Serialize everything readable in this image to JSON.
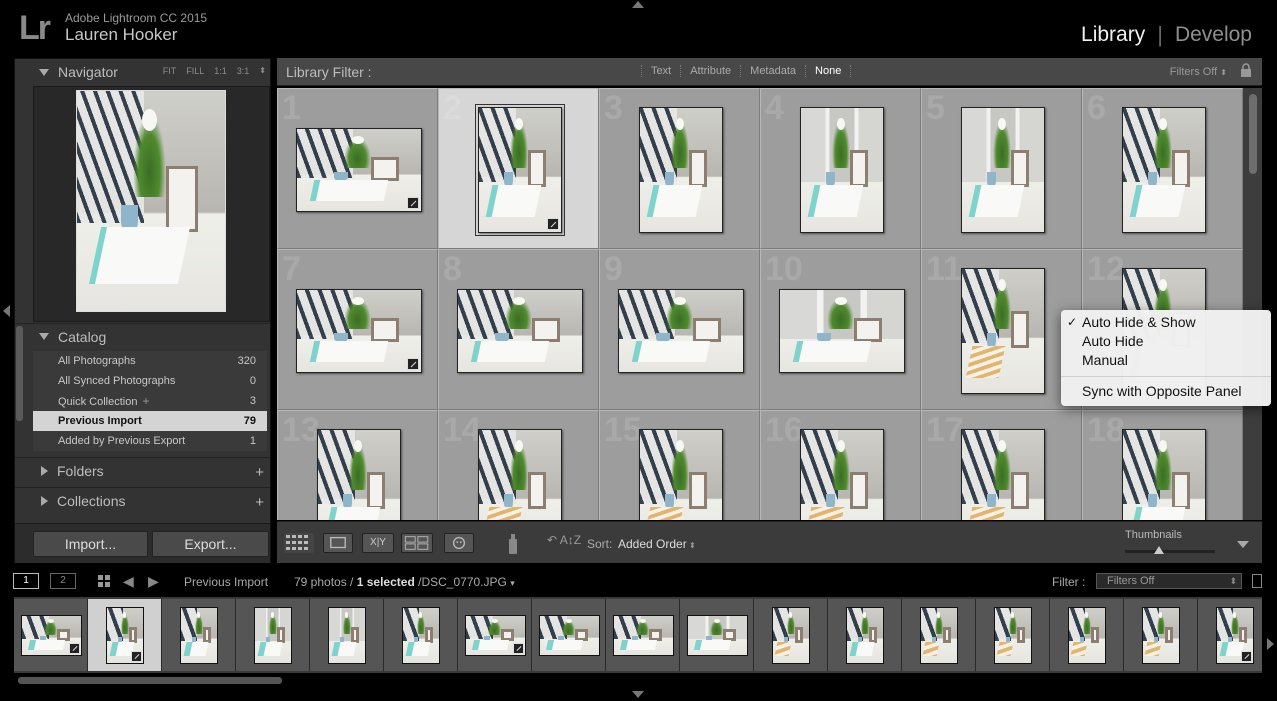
{
  "app": {
    "logo": "Lr",
    "product": "Adobe Lightroom CC 2015",
    "user": "Lauren Hooker",
    "modules": [
      "Library",
      "Develop"
    ],
    "active_module": "Library"
  },
  "navigator": {
    "title": "Navigator",
    "modes": [
      "FIT",
      "FILL",
      "1:1",
      "3:1"
    ]
  },
  "catalog": {
    "title": "Catalog",
    "items": [
      {
        "label": "All Photographs",
        "count": "320"
      },
      {
        "label": "All Synced Photographs",
        "count": "0"
      },
      {
        "label": "Quick Collection",
        "count": "3",
        "plus": "+"
      },
      {
        "label": "Previous Import",
        "count": "79",
        "selected": true
      },
      {
        "label": "Added by Previous Export",
        "count": "1"
      }
    ]
  },
  "folders": {
    "title": "Folders",
    "add": "+"
  },
  "collections": {
    "title": "Collections",
    "add": "+"
  },
  "left_buttons": {
    "import": "Import...",
    "export": "Export..."
  },
  "library_filter": {
    "title": "Library Filter :",
    "tabs": [
      "Text",
      "Attribute",
      "Metadata",
      "None"
    ],
    "active_tab": "None",
    "preset": "Filters Off"
  },
  "grid": {
    "cells": [
      {
        "num": "1",
        "orient": "landscape",
        "badge": true,
        "style": "day"
      },
      {
        "num": "2",
        "orient": "portrait",
        "badge": true,
        "style": "day",
        "selected": true
      },
      {
        "num": "3",
        "orient": "portrait",
        "badge": false,
        "style": "day"
      },
      {
        "num": "4",
        "orient": "portrait",
        "badge": false,
        "style": "window"
      },
      {
        "num": "5",
        "orient": "portrait",
        "badge": false,
        "style": "window"
      },
      {
        "num": "6",
        "orient": "portrait",
        "badge": false,
        "style": "day"
      },
      {
        "num": "7",
        "orient": "landscape",
        "badge": true,
        "style": "day"
      },
      {
        "num": "8",
        "orient": "landscape",
        "badge": false,
        "style": "day"
      },
      {
        "num": "9",
        "orient": "landscape",
        "badge": false,
        "style": "day"
      },
      {
        "num": "10",
        "orient": "landscape",
        "badge": false,
        "style": "window"
      },
      {
        "num": "11",
        "orient": "portrait",
        "badge": false,
        "style": "stripes"
      },
      {
        "num": "12",
        "orient": "portrait",
        "badge": false,
        "style": "day"
      },
      {
        "num": "13",
        "orient": "portrait",
        "badge": false,
        "style": "day"
      },
      {
        "num": "14",
        "orient": "portrait",
        "badge": false,
        "style": "stripes"
      },
      {
        "num": "15",
        "orient": "portrait",
        "badge": false,
        "style": "stripes"
      },
      {
        "num": "16",
        "orient": "portrait",
        "badge": false,
        "style": "stripes"
      },
      {
        "num": "17",
        "orient": "portrait",
        "badge": false,
        "style": "stripes"
      },
      {
        "num": "18",
        "orient": "portrait",
        "badge": false,
        "style": "day"
      }
    ]
  },
  "toolbar": {
    "sort_label": "Sort:",
    "sort_value": "Added Order",
    "thumbnails_label": "Thumbnails",
    "thumb_size": 0.38
  },
  "filmstrip_header": {
    "monitor1": "1",
    "monitor2": "2",
    "source": "Previous Import",
    "count_prefix": "79 photos /",
    "selected": "1 selected",
    "filename": "/DSC_0770.JPG",
    "filter_label": "Filter :",
    "filter_value": "Filters Off"
  },
  "filmstrip": {
    "items": [
      {
        "orient": "landscape",
        "badge": true,
        "style": "day"
      },
      {
        "orient": "portrait",
        "badge": true,
        "style": "day",
        "selected": true
      },
      {
        "orient": "portrait",
        "badge": false,
        "style": "day"
      },
      {
        "orient": "portrait",
        "badge": false,
        "style": "window"
      },
      {
        "orient": "portrait",
        "badge": false,
        "style": "window"
      },
      {
        "orient": "portrait",
        "badge": false,
        "style": "day"
      },
      {
        "orient": "landscape",
        "badge": true,
        "style": "day"
      },
      {
        "orient": "landscape",
        "badge": false,
        "style": "day"
      },
      {
        "orient": "landscape",
        "badge": false,
        "style": "day"
      },
      {
        "orient": "landscape",
        "badge": false,
        "style": "window"
      },
      {
        "orient": "portrait",
        "badge": false,
        "style": "stripes"
      },
      {
        "orient": "portrait",
        "badge": false,
        "style": "day"
      },
      {
        "orient": "portrait",
        "badge": false,
        "style": "stripes"
      },
      {
        "orient": "portrait",
        "badge": false,
        "style": "stripes"
      },
      {
        "orient": "portrait",
        "badge": false,
        "style": "stripes"
      },
      {
        "orient": "portrait",
        "badge": false,
        "style": "stripes"
      },
      {
        "orient": "portrait",
        "badge": true,
        "style": "day"
      }
    ]
  },
  "context_menu": {
    "items": [
      "Auto Hide & Show",
      "Auto Hide",
      "Manual"
    ],
    "checked": "Auto Hide & Show",
    "extra": "Sync with Opposite Panel"
  }
}
